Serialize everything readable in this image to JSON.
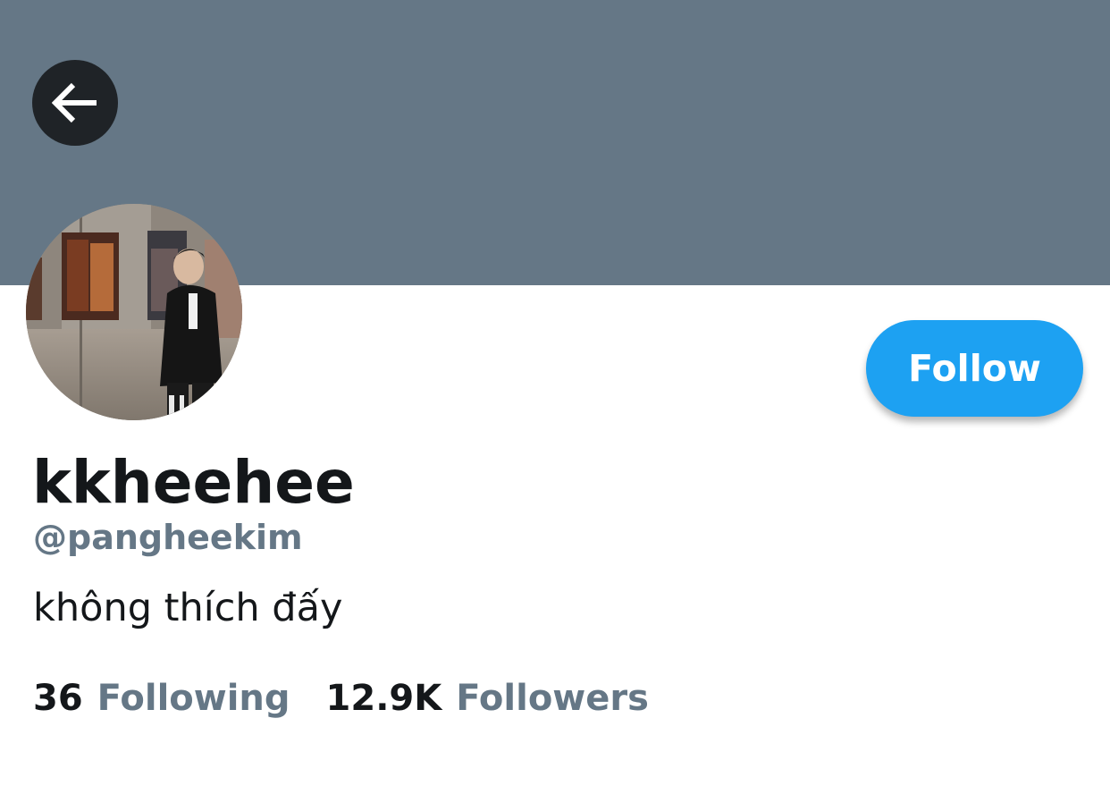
{
  "colors": {
    "banner": "#657786",
    "accent": "#1da1f2",
    "text_primary": "#14171a",
    "text_secondary": "#657786"
  },
  "header": {
    "back_icon": "arrow-left-icon"
  },
  "profile": {
    "display_name": "kkheehee",
    "handle": "@pangheekim",
    "bio": "không thích đấy",
    "follow_label": "Follow"
  },
  "stats": {
    "following_count": "36",
    "following_label": "Following",
    "followers_count": "12.9K",
    "followers_label": "Followers"
  }
}
